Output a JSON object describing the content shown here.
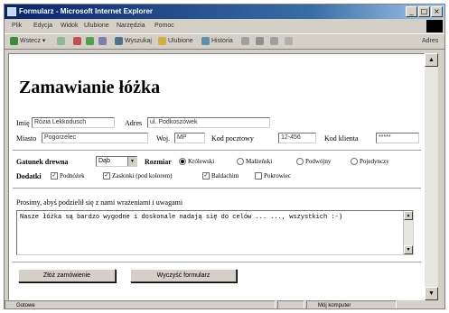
{
  "window": {
    "title": "Formularz - Microsoft Internet Explorer",
    "controls": [
      "_",
      "□",
      "×"
    ]
  },
  "menu": [
    "Plik",
    "Edycja",
    "Widok",
    "Ulubione",
    "Narzędzia",
    "Pomoc"
  ],
  "toolbar": {
    "back": "Wstecz",
    "search": "Wyszukaj",
    "favorites": "Ulubione",
    "history": "Historia",
    "address_label": "Adres"
  },
  "page": {
    "heading": "Zamawianie łóżka",
    "fields": {
      "name_label": "Imię",
      "name_value": "Rózia Lekkodusch",
      "address_label": "Adres",
      "address_value": "ul. Podkoszówek",
      "city_label": "Miasto",
      "city_value": "Pogorzelec",
      "province_label": "Woj.",
      "province_value": "MP",
      "zip_label": "Kod pocztowy",
      "zip_value": "12-456",
      "code_label": "Kod klienta",
      "code_value": "*****"
    },
    "wood": {
      "label": "Gatunek drewna",
      "selected": "Dąb"
    },
    "size": {
      "label": "Rozmiar",
      "options": [
        "Królewski",
        "Małżeński",
        "Podwójny",
        "Pojedynczy"
      ],
      "selected_index": 0
    },
    "extras": {
      "label": "Dodatki",
      "options": [
        "Podnóżek",
        "Zasłonki (pod kolorem)",
        "Baldachim",
        "Pokrowiec"
      ],
      "checked": [
        true,
        true,
        true,
        false
      ]
    },
    "comments": {
      "label": "Prosimy, abyś podzielił się z nami wrażeniami i uwagami",
      "text": "Nasze łóżka są bardzo wygodne i doskonale nadają się do celów ... ..., wszystkich :-)"
    },
    "buttons": {
      "submit": "Złóż zamówienie",
      "reset": "Wyczyść formularz"
    }
  },
  "status": {
    "left": "Gotowe",
    "zone": "Mój komputer"
  }
}
